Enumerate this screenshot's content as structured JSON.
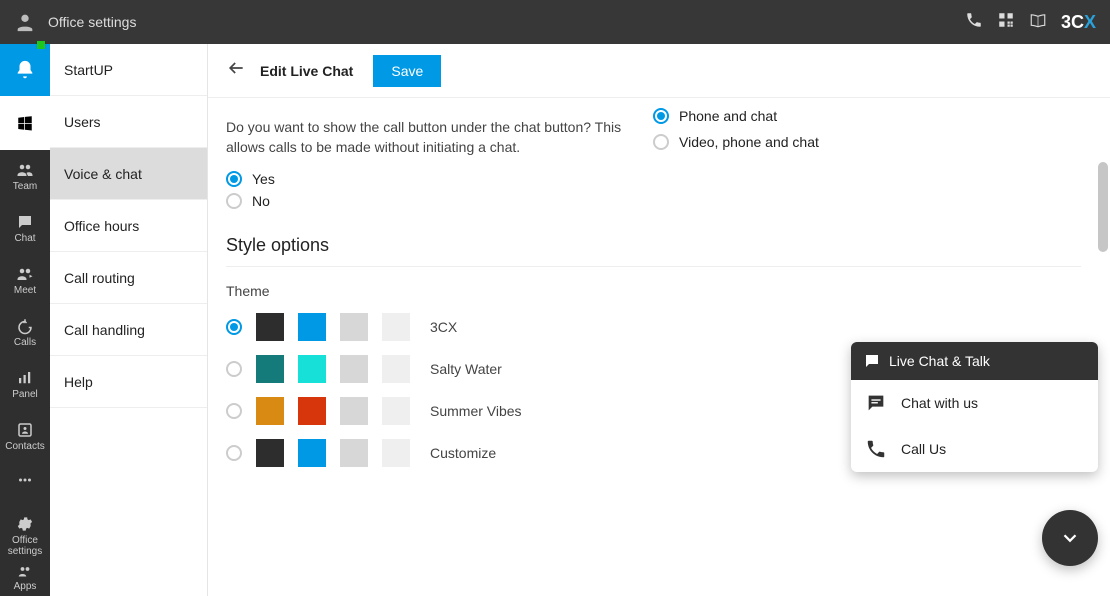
{
  "header": {
    "title": "Office settings"
  },
  "brand": {
    "text1": "3C",
    "text2": "X"
  },
  "rail": {
    "team": "Team",
    "chat": "Chat",
    "meet": "Meet",
    "calls": "Calls",
    "panel": "Panel",
    "contacts": "Contacts",
    "officeSettings1": "Office",
    "officeSettings2": "settings",
    "apps": "Apps"
  },
  "submenu": {
    "startup": "StartUP",
    "users": "Users",
    "voiceChat": "Voice & chat",
    "officeHours": "Office hours",
    "callRouting": "Call routing",
    "callHandling": "Call handling",
    "help": "Help"
  },
  "page": {
    "title": "Edit Live Chat",
    "saveLabel": "Save"
  },
  "commOptions": {
    "phoneChat": "Phone and chat",
    "videoPhoneChat": "Video, phone and chat"
  },
  "callButton": {
    "question": "Do you want to show the call button under the chat button? This allows calls to be made without initiating a chat.",
    "yes": "Yes",
    "no": "No"
  },
  "style": {
    "section": "Style options",
    "theme": "Theme",
    "themes": {
      "t3cx": {
        "name": "3CX",
        "c1": "#2d2d2d",
        "c2": "#0099e6",
        "c3": "#d7d7d7",
        "c4": "#efefef"
      },
      "salty": {
        "name": "Salty Water",
        "c1": "#157a7a",
        "c2": "#16e0d8",
        "c3": "#d7d7d7",
        "c4": "#efefef"
      },
      "summer": {
        "name": "Summer Vibes",
        "c1": "#d88a13",
        "c2": "#d7360d",
        "c3": "#d7d7d7",
        "c4": "#efefef"
      },
      "custom": {
        "name": "Customize",
        "c1": "#2d2d2d",
        "c2": "#0099e6",
        "c3": "#d7d7d7",
        "c4": "#efefef"
      }
    }
  },
  "chatWidget": {
    "title": "Live Chat & Talk",
    "chat": "Chat with us",
    "call": "Call Us"
  }
}
